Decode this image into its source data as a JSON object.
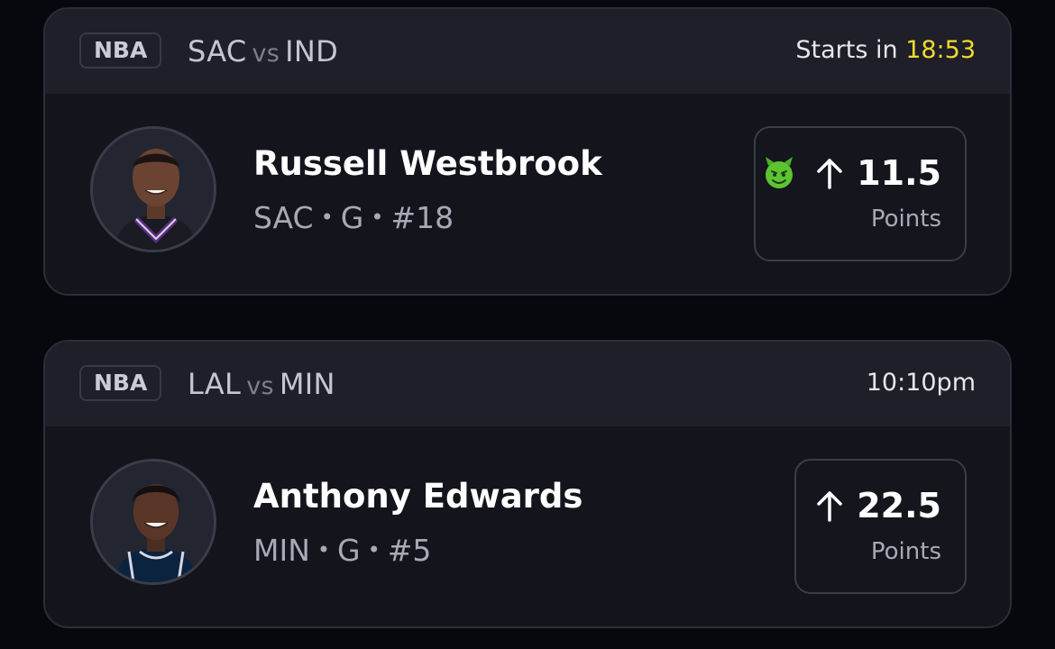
{
  "cards": [
    {
      "league": "NBA",
      "team_a": "SAC",
      "vs": "vs",
      "team_b": "IND",
      "time_prefix": "Starts in ",
      "time_value": "18:53",
      "player_name": "Russell Westbrook",
      "player_team": "SAC",
      "player_position": "G",
      "player_number": "#18",
      "pick_direction": "up-arrow-icon",
      "pick_value": "11.5",
      "pick_stat": "Points",
      "badge_icon": "green-devil-emoji-icon",
      "jersey_color": "#5a2d82"
    },
    {
      "league": "NBA",
      "team_a": "LAL",
      "vs": "vs",
      "team_b": "MIN",
      "time_prefix": "",
      "time_value": "10:10pm",
      "player_name": "Anthony Edwards",
      "player_team": "MIN",
      "player_position": "G",
      "player_number": "#5",
      "pick_direction": "up-arrow-icon",
      "pick_value": "22.5",
      "pick_stat": "Points",
      "jersey_color": "#0c2340"
    }
  ],
  "separator": "•",
  "colors": {
    "accent_timer": "#f2da2b",
    "background": "#07080d",
    "card": "#13141c",
    "card_header": "#1e1f29"
  }
}
